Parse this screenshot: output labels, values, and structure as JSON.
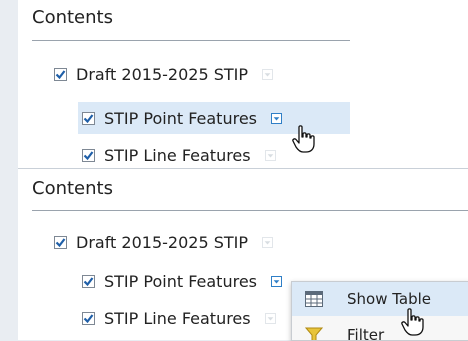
{
  "top": {
    "title": "Contents",
    "layers": [
      {
        "label": "Draft 2015-2025 STIP",
        "checked": true
      },
      {
        "label": "STIP Point Features",
        "checked": true
      },
      {
        "label": "STIP Line Features",
        "checked": true
      }
    ]
  },
  "bottom": {
    "title": "Contents",
    "layers": [
      {
        "label": "Draft 2015-2025 STIP",
        "checked": true
      },
      {
        "label": "STIP Point Features",
        "checked": true
      },
      {
        "label": "STIP Line Features",
        "checked": true
      }
    ]
  },
  "context_menu": {
    "items": [
      {
        "label": "Show Table",
        "icon": "table-icon"
      },
      {
        "label": "Filter",
        "icon": "filter-icon"
      }
    ]
  },
  "colors": {
    "accent": "#2f7fc7",
    "highlight": "#dbe9f7"
  }
}
